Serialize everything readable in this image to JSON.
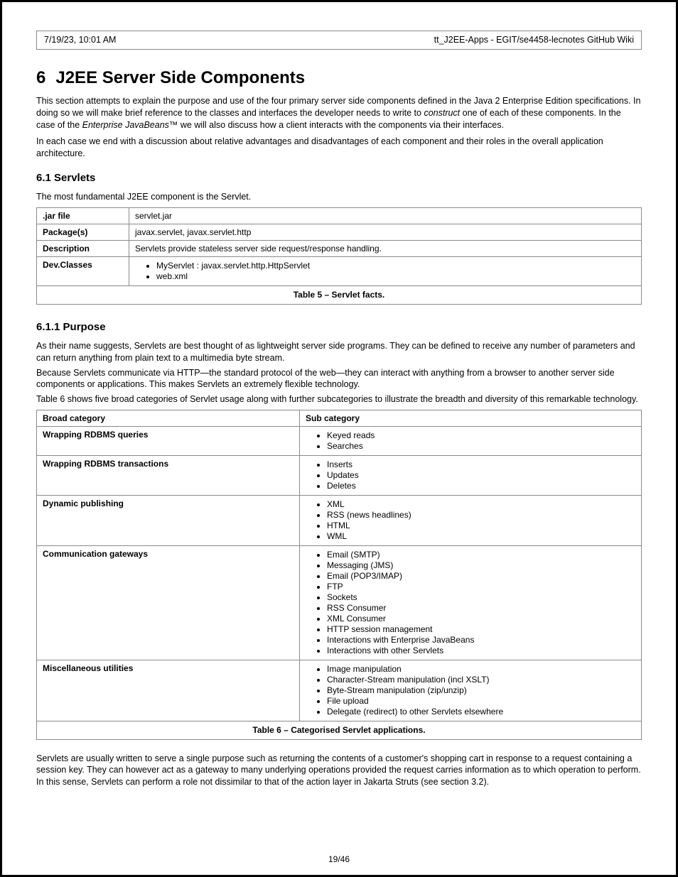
{
  "header": {
    "left": "7/19/23, 10:01 AM",
    "right": "tt_J2EE-Apps - EGIT/se4458-lecnotes GitHub Wiki"
  },
  "title": {
    "num": "6",
    "text": "J2EE Server Side Components"
  },
  "para1_parts": [
    "This section attempts to explain the purpose and use of the four primary server side components defined in the Java 2 Enterprise Edition specifications. In doing so we will make brief reference to the classes and interfaces the developer needs to write to ",
    "construct",
    " one of each of these components. In the case of the "
  ],
  "para1_ejb": "Enterprise JavaBeans™",
  "para1_tail": " we will also discuss how a client interacts with the components via their interfaces.",
  "para2": "In each case we end with a discussion about relative advantages and disadvantages of each component and their roles in the overall application architecture.",
  "subsection_title": "6.1 Servlets",
  "servlet_intro": "The most fundamental J2EE component is the Servlet.",
  "table1": {
    "rows": [
      {
        "label": ".jar file",
        "value": "servlet.jar"
      },
      {
        "label": "Package(s)",
        "value": "javax.servlet, javax.servlet.http"
      },
      {
        "label": "Description",
        "value": "Servlets provide stateless server side request/response handling."
      },
      {
        "label": "Dev.Classes",
        "items": [
          "MyServlet : javax.servlet.http.HttpServlet",
          "web.xml "
        ]
      }
    ],
    "caption": "Table 5 – Servlet facts."
  },
  "subsub_title": "6.1.1 Purpose",
  "purpose_para1": "As their name suggests, Servlets are best thought of as lightweight server side programs. They can be defined to receive any number of parameters and can return anything from plain text to a multimedia byte stream.",
  "purpose_para2": "Because Servlets communicate via HTTP—the standard protocol of the web—they can interact with anything from a browser to another server side components or applications. This makes Servlets an extremely flexible technology.",
  "purpose_para3": "Table 6 shows five broad categories of Servlet usage along with further subcategories to illustrate the breadth and diversity of this remarkable technology.",
  "table2": {
    "headers": [
      "Broad category",
      "Sub category"
    ],
    "rows": [
      {
        "cat": "Wrapping RDBMS queries",
        "items": [
          "Keyed reads",
          "Searches"
        ]
      },
      {
        "cat": "Wrapping RDBMS transactions",
        "items": [
          "Inserts",
          "Updates",
          "Deletes"
        ]
      },
      {
        "cat": "Dynamic publishing",
        "items": [
          "XML",
          "RSS (news headlines)",
          "HTML",
          "WML"
        ]
      },
      {
        "cat": "Communication gateways",
        "items": [
          "Email (SMTP)",
          "Messaging (JMS)",
          "Email (POP3/IMAP)",
          "FTP",
          "Sockets",
          "RSS Consumer",
          "XML Consumer",
          "HTTP session management",
          "Interactions with Enterprise JavaBeans",
          "Interactions with other Servlets"
        ]
      },
      {
        "cat": "Miscellaneous utilities",
        "items": [
          "Image manipulation",
          "Character-Stream manipulation (incl XSLT)",
          "Byte-Stream manipulation (zip/unzip)",
          "File upload",
          "Delegate (redirect) to other Servlets elsewhere"
        ]
      }
    ],
    "caption": "Table 6 – Categorised Servlet applications."
  },
  "tail_para": "Servlets are usually written to serve a single purpose such as returning the contents of a customer's shopping cart in response to a request containing a session key. They can however act as a gateway to many underlying operations provided the request carries information as to which operation to perform. In this sense, Servlets can perform a role not dissimilar to that of the action layer in Jakarta Struts (see section 3.2).",
  "page_number": "19/46"
}
